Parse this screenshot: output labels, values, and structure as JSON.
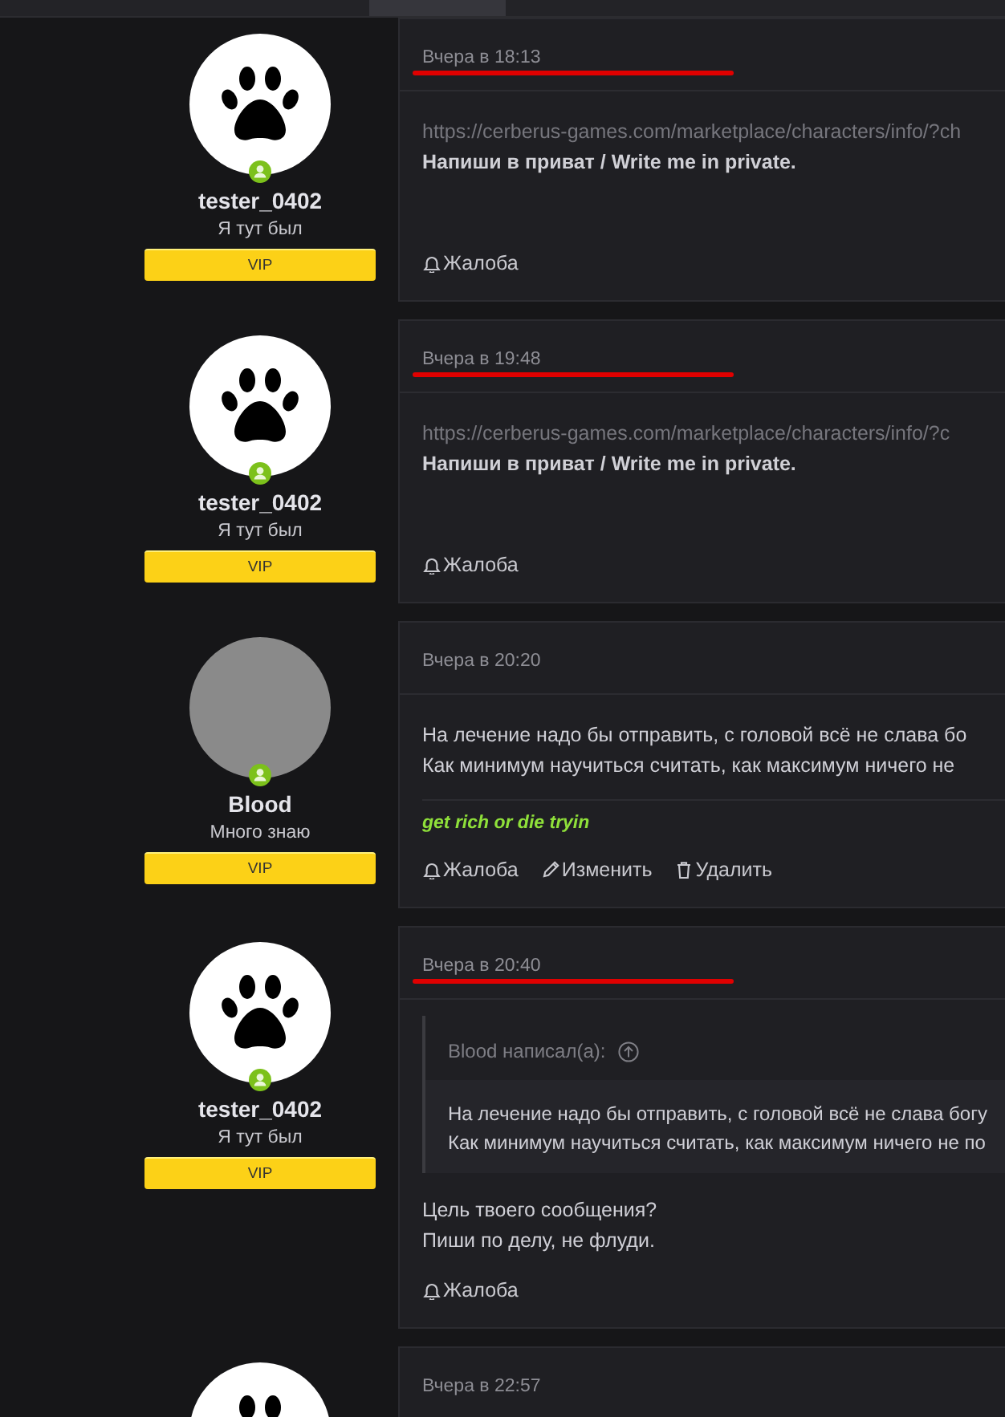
{
  "posts": [
    {
      "author": {
        "name": "tester_0402",
        "title": "Я тут был",
        "badge": "VIP",
        "avatar": {
          "kind": "paw"
        },
        "online": true
      },
      "time": "Вчера в 18:13",
      "marked": true,
      "lines": [
        {
          "kind": "link",
          "text": "https://cerberus-games.com/marketplace/characters/info/?ch"
        },
        {
          "kind": "strong",
          "text": "Напиши в приват / Write me in private."
        }
      ],
      "actions": [
        {
          "kind": "bell",
          "label": "Жалоба"
        }
      ]
    },
    {
      "author": {
        "name": "tester_0402",
        "title": "Я тут был",
        "badge": "VIP",
        "avatar": {
          "kind": "paw"
        },
        "online": true
      },
      "time": "Вчера в 19:48",
      "marked": true,
      "lines": [
        {
          "kind": "link",
          "text": "https://cerberus-games.com/marketplace/characters/info/?c"
        },
        {
          "kind": "strong",
          "text": "Напиши в приват / Write me in private."
        }
      ],
      "actions": [
        {
          "kind": "bell",
          "label": "Жалоба"
        }
      ]
    },
    {
      "author": {
        "name": "Blood",
        "title": "Много знаю",
        "badge": "VIP",
        "avatar": {
          "kind": "photo"
        },
        "online": true
      },
      "time": "Вчера в 20:20",
      "lines": [
        {
          "kind": "plain",
          "text": "На лечение надо бы отправить, с головой всё не слава бо"
        },
        {
          "kind": "plain",
          "text": "Как минимум научиться считать, как максимум ничего не"
        }
      ],
      "signature": "get rich or die tryin",
      "actions": [
        {
          "kind": "bell",
          "label": "Жалоба"
        },
        {
          "kind": "pencil",
          "label": "Изменить"
        },
        {
          "kind": "trash",
          "label": "Удалить"
        }
      ]
    },
    {
      "author": {
        "name": "tester_0402",
        "title": "Я тут был",
        "badge": "VIP",
        "avatar": {
          "kind": "paw"
        },
        "online": true
      },
      "time": "Вчера в 20:40",
      "marked": true,
      "quote": {
        "author": "Blood написал(а):",
        "lines": [
          "На лечение надо бы отправить, с головой всё не слава богу",
          "Как минимум научиться считать, как максимум ничего не по"
        ]
      },
      "lines": [
        {
          "kind": "plain",
          "text": "Цель твоего сообщения?"
        },
        {
          "kind": "plain",
          "text": "Пиши по делу, не флуди."
        }
      ],
      "actions": [
        {
          "kind": "bell",
          "label": "Жалоба"
        }
      ]
    },
    {
      "author": {
        "avatar": {
          "kind": "paw"
        }
      },
      "time": "Вчера в 22:57"
    }
  ]
}
